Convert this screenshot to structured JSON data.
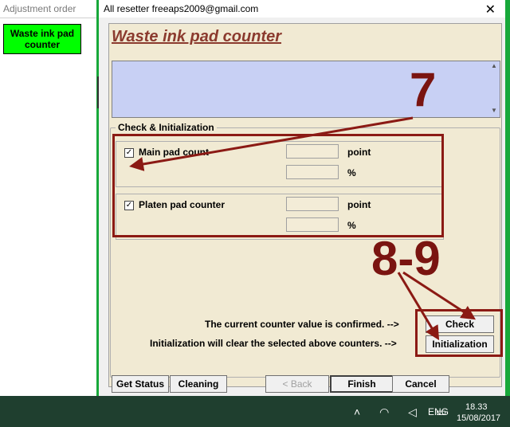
{
  "left_window": {
    "title": "Adjustment order",
    "waste_button_label": "Waste ink pad counter"
  },
  "dialog": {
    "title": "All resetter freeaps2009@gmail.com",
    "close_glyph": "✕",
    "heading": "Waste ink pad counter",
    "group_label": "Check & Initialization",
    "main_pad": {
      "label": "Main pad count",
      "unit1": "point",
      "unit2": "%"
    },
    "platen_pad": {
      "label": "Platen pad counter",
      "unit1": "point",
      "unit2": "%"
    },
    "msg_check": "The current counter value is confirmed. -->",
    "msg_init": "Initialization will clear the selected above counters. -->",
    "btn_check": "Check",
    "btn_init": "Initialization",
    "btn_getstatus": "Get Status",
    "btn_cleaning": "Cleaning",
    "btn_back": "< Back",
    "btn_finish": "Finish",
    "btn_cancel": "Cancel"
  },
  "annotations": {
    "step_a": "7",
    "step_b": "8-9",
    "color": "#8b1a14"
  },
  "taskbar": {
    "lang": "ENG",
    "time": "18.33",
    "date": "15/08/2017"
  }
}
